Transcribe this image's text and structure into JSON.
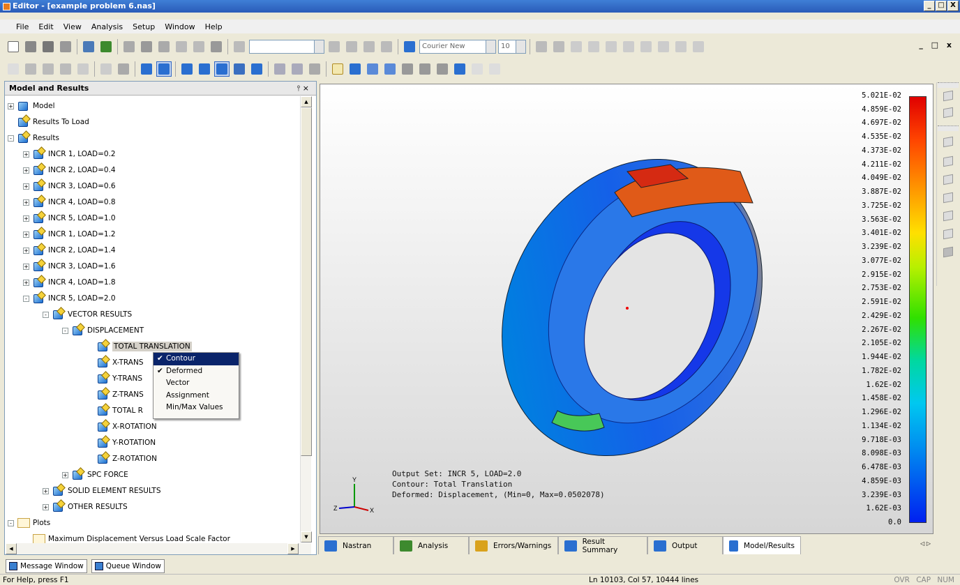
{
  "window": {
    "title": "Editor - [example problem 6.nas]",
    "min": "_",
    "max": "□",
    "close": "X"
  },
  "menu": [
    "File",
    "Edit",
    "View",
    "Analysis",
    "Setup",
    "Window",
    "Help"
  ],
  "mdi_controls": "_ □ x",
  "toolbar": {
    "font_name": "Courier New",
    "font_size": "10"
  },
  "panel": {
    "title": "Model and Results",
    "pin": "⫯ ×"
  },
  "tree": [
    {
      "label": "Model",
      "level": 0,
      "exp": "+",
      "icon": "cube"
    },
    {
      "label": "Results To Load",
      "level": 0,
      "exp": "",
      "icon": "load"
    },
    {
      "label": "Results",
      "level": 0,
      "exp": "-",
      "icon": "pen"
    },
    {
      "label": "INCR 1, LOAD=0.2",
      "level": 1,
      "exp": "+",
      "icon": "pen"
    },
    {
      "label": "INCR 2, LOAD=0.4",
      "level": 1,
      "exp": "+",
      "icon": "pen"
    },
    {
      "label": "INCR 3, LOAD=0.6",
      "level": 1,
      "exp": "+",
      "icon": "pen"
    },
    {
      "label": "INCR 4, LOAD=0.8",
      "level": 1,
      "exp": "+",
      "icon": "pen"
    },
    {
      "label": "INCR 5, LOAD=1.0",
      "level": 1,
      "exp": "+",
      "icon": "pen"
    },
    {
      "label": "INCR 1, LOAD=1.2",
      "level": 1,
      "exp": "+",
      "icon": "pen"
    },
    {
      "label": "INCR 2, LOAD=1.4",
      "level": 1,
      "exp": "+",
      "icon": "pen"
    },
    {
      "label": "INCR 3, LOAD=1.6",
      "level": 1,
      "exp": "+",
      "icon": "pen"
    },
    {
      "label": "INCR 4, LOAD=1.8",
      "level": 1,
      "exp": "+",
      "icon": "pen"
    },
    {
      "label": "INCR 5, LOAD=2.0",
      "level": 1,
      "exp": "-",
      "icon": "pen"
    },
    {
      "label": "VECTOR RESULTS",
      "level": 2,
      "exp": "-",
      "icon": "pen"
    },
    {
      "label": "DISPLACEMENT",
      "level": 3,
      "exp": "-",
      "icon": "pen"
    },
    {
      "label": "TOTAL TRANSLATION",
      "level": 4,
      "exp": "",
      "icon": "pen",
      "selected": true
    },
    {
      "label": "X-TRANS",
      "level": 4,
      "exp": "",
      "icon": "pen"
    },
    {
      "label": "Y-TRANS",
      "level": 4,
      "exp": "",
      "icon": "pen"
    },
    {
      "label": "Z-TRANS",
      "level": 4,
      "exp": "",
      "icon": "pen"
    },
    {
      "label": "TOTAL R",
      "level": 4,
      "exp": "",
      "icon": "pen"
    },
    {
      "label": "X-ROTATION",
      "level": 4,
      "exp": "",
      "icon": "pen"
    },
    {
      "label": "Y-ROTATION",
      "level": 4,
      "exp": "",
      "icon": "pen"
    },
    {
      "label": "Z-ROTATION",
      "level": 4,
      "exp": "",
      "icon": "pen"
    },
    {
      "label": "SPC FORCE",
      "level": 3,
      "exp": "+",
      "icon": "pen"
    },
    {
      "label": "SOLID ELEMENT RESULTS",
      "level": 2,
      "exp": "+",
      "icon": "pen"
    },
    {
      "label": "OTHER RESULTS",
      "level": 2,
      "exp": "+",
      "icon": "pen"
    },
    {
      "label": "Plots",
      "level": 0,
      "exp": "-",
      "icon": "plot"
    },
    {
      "label": "Maximum Displacement Versus Load Scale Factor",
      "level": 1,
      "exp": "",
      "icon": "plot"
    }
  ],
  "context_menu": [
    {
      "label": "Contour",
      "checked": true,
      "highlighted": true
    },
    {
      "label": "Deformed",
      "checked": true,
      "highlighted": false
    },
    {
      "label": "Vector",
      "checked": false,
      "highlighted": false
    },
    {
      "label": "Assignment",
      "checked": false,
      "highlighted": false
    },
    {
      "label": "Min/Max Values",
      "checked": false,
      "highlighted": false
    }
  ],
  "legend": [
    "5.021E-02",
    "4.859E-02",
    "4.697E-02",
    "4.535E-02",
    "4.373E-02",
    "4.211E-02",
    "4.049E-02",
    "3.887E-02",
    "3.725E-02",
    "3.563E-02",
    "3.401E-02",
    "3.239E-02",
    "3.077E-02",
    "2.915E-02",
    "2.753E-02",
    "2.591E-02",
    "2.429E-02",
    "2.267E-02",
    "2.105E-02",
    "1.944E-02",
    "1.782E-02",
    "1.62E-02",
    "1.458E-02",
    "1.296E-02",
    "1.134E-02",
    "9.718E-03",
    "8.098E-03",
    "6.478E-03",
    "4.859E-03",
    "3.239E-03",
    "1.62E-03",
    "0.0"
  ],
  "viewport_info": {
    "line1": "Output Set: INCR 5, LOAD=2.0",
    "line2": "Contour: Total Translation",
    "line3": "Deformed: Displacement, (Min=0, Max=0.0502078)"
  },
  "axes": {
    "x": "X",
    "y": "Y",
    "z": "Z"
  },
  "tabs": [
    {
      "label": "Nastran",
      "color": "#2a6fd0"
    },
    {
      "label": "Analysis",
      "color": "#3d8a2e"
    },
    {
      "label": "Errors/Warnings",
      "color": "#d9a21c"
    },
    {
      "label": "Result Summary",
      "color": "#2a6fd0"
    },
    {
      "label": "Output",
      "color": "#2a6fd0"
    },
    {
      "label": "Model/Results",
      "color": "#2a6fd0"
    }
  ],
  "tab_arrows": "◁ ▷",
  "bottom_tabs": [
    "Message Window",
    "Queue Window"
  ],
  "status": {
    "left": "For Help, press F1",
    "mid": "Ln 10103, Col 57, 10444 lines",
    "right": "OVR CAP NUM"
  }
}
